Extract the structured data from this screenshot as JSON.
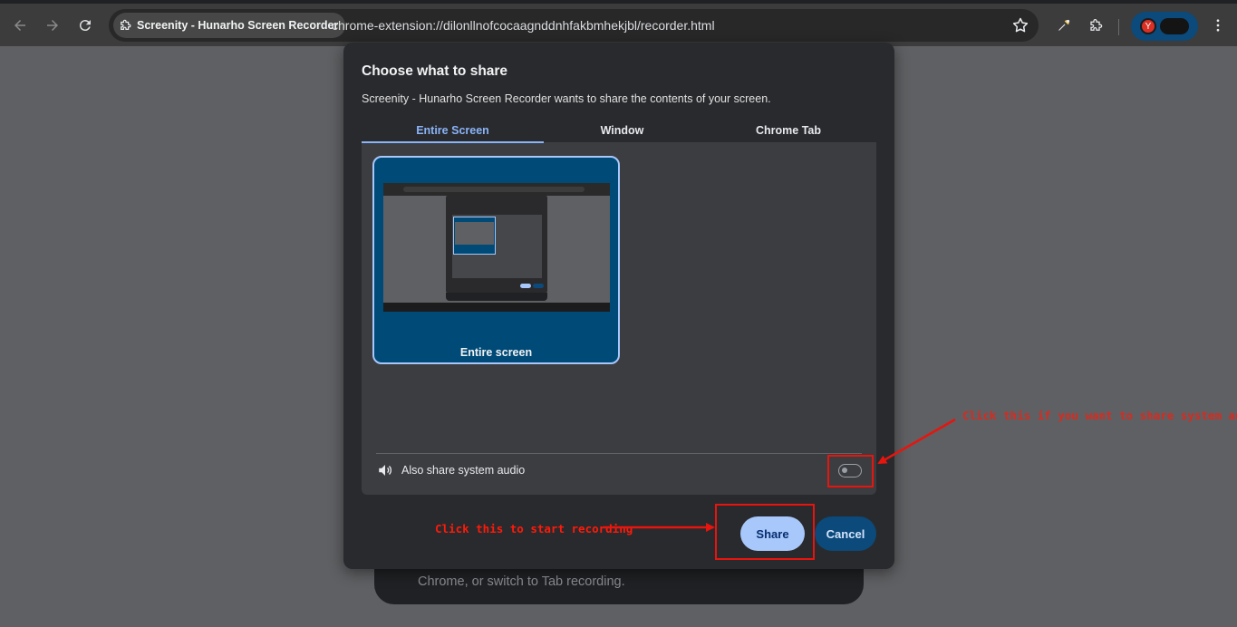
{
  "browser": {
    "tab_chip_label": "Screenity - Hunarho Screen Recorder",
    "url": "chrome-extension://dilonllnofcocaagnddnhfakbmhekjbl/recorder.html",
    "profile_initial": "Y",
    "icons": [
      "back-icon",
      "forward-icon",
      "reload-icon",
      "extension-icon",
      "star-icon",
      "eyedropper-icon",
      "puzzle-icon",
      "menu-icon"
    ]
  },
  "background_page": {
    "text": "Chrome, or switch to Tab recording."
  },
  "dialog": {
    "title": "Choose what to share",
    "subtitle": "Screenity - Hunarho Screen Recorder wants to share the contents of your screen.",
    "tabs": [
      {
        "label": "Entire Screen",
        "active": true
      },
      {
        "label": "Window",
        "active": false
      },
      {
        "label": "Chrome Tab",
        "active": false
      }
    ],
    "tile_label": "Entire screen",
    "audio_label": "Also share system audio",
    "audio_enabled": false,
    "share_label": "Share",
    "cancel_label": "Cancel"
  },
  "annotations": {
    "audio_hint": "Click this if you want to share system audio",
    "share_hint": "Click this to start recording",
    "color": "#e8140e"
  }
}
